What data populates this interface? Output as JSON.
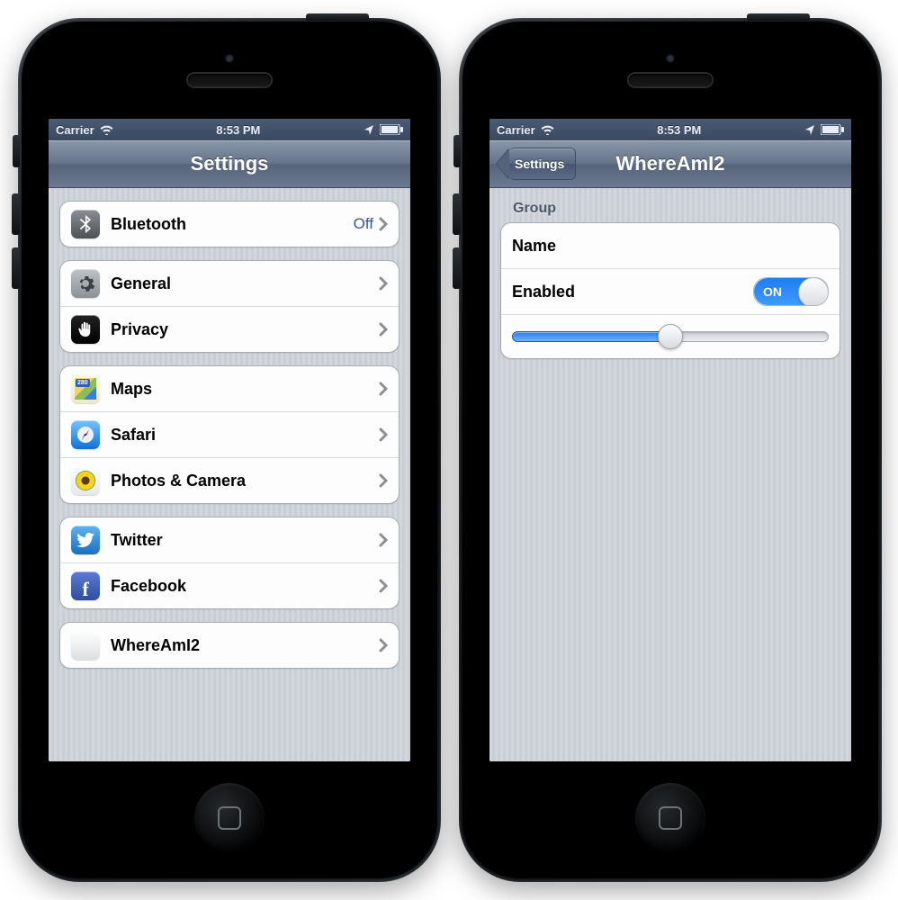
{
  "status": {
    "carrier": "Carrier",
    "time": "8:53 PM"
  },
  "left": {
    "title": "Settings",
    "groups": [
      {
        "rows": [
          {
            "icon": "bluetooth",
            "label": "Bluetooth",
            "value": "Off"
          }
        ]
      },
      {
        "rows": [
          {
            "icon": "general",
            "label": "General"
          },
          {
            "icon": "privacy",
            "label": "Privacy"
          }
        ]
      },
      {
        "rows": [
          {
            "icon": "maps",
            "label": "Maps"
          },
          {
            "icon": "safari",
            "label": "Safari"
          },
          {
            "icon": "photos",
            "label": "Photos & Camera"
          }
        ]
      },
      {
        "rows": [
          {
            "icon": "twitter",
            "label": "Twitter"
          },
          {
            "icon": "facebook",
            "label": "Facebook"
          }
        ]
      },
      {
        "rows": [
          {
            "icon": "blank",
            "label": "WhereAmI2"
          }
        ]
      }
    ]
  },
  "right": {
    "back": "Settings",
    "title": "WhereAmI2",
    "group_header": "Group",
    "name_label": "Name",
    "enabled_label": "Enabled",
    "toggle_value": "ON",
    "slider_value": 0.5
  }
}
